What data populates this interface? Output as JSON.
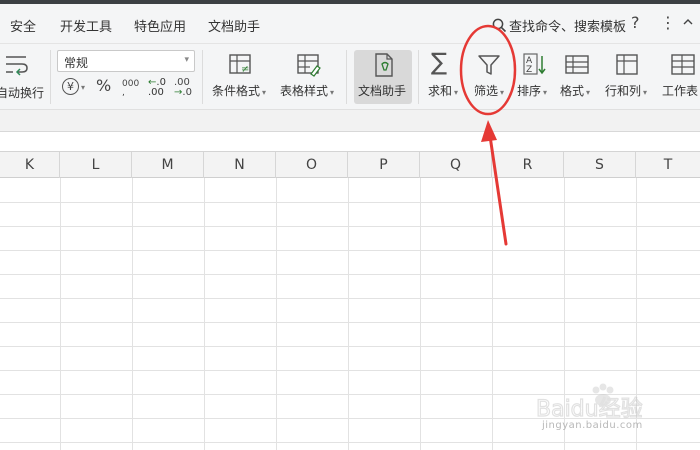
{
  "menu": {
    "items": [
      "安全",
      "开发工具",
      "特色应用",
      "文档助手"
    ],
    "search_label": "查找命令、搜索模板",
    "help": "?",
    "more": "⋮"
  },
  "ribbon": {
    "wrap_label": "自动换行",
    "number_format": "常规",
    "currency_symbol": "¥",
    "percent_symbol": "%",
    "thousands_symbol": "000",
    "dec_inc": ".00",
    "dec_dec": ".0",
    "conditional_format": "条件格式",
    "table_style": "表格样式",
    "doc_assistant": "文档助手",
    "sum": "求和",
    "filter": "筛选",
    "sort": "排序",
    "format": "格式",
    "rows_cols": "行和列",
    "worksheet": "工作表"
  },
  "sheet": {
    "columns": [
      "K",
      "L",
      "M",
      "N",
      "O",
      "P",
      "Q",
      "R",
      "S",
      "T"
    ]
  },
  "watermark": {
    "logo": "Baidu经验",
    "url": "jingyan.baidu.com"
  },
  "colors": {
    "annotation": "#e53935",
    "active_button": "#d9d9d9"
  }
}
